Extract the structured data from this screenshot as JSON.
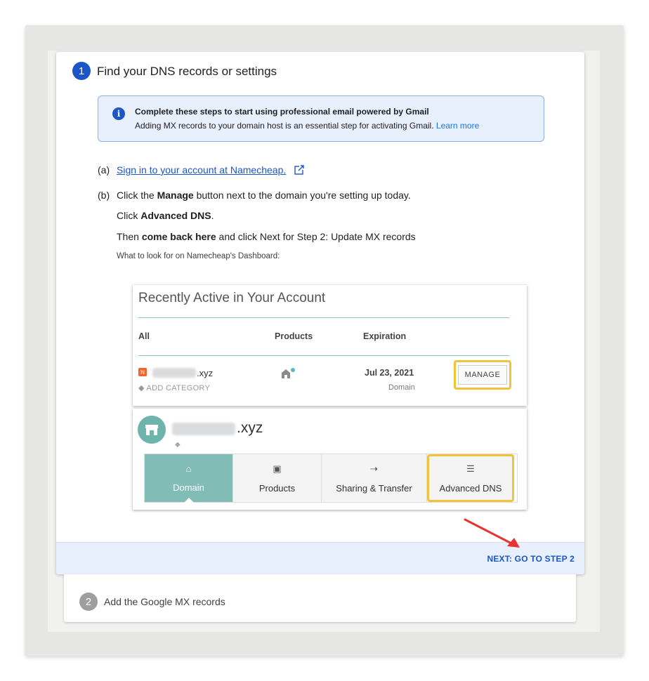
{
  "step1": {
    "number": "1",
    "title": "Find your DNS records or settings",
    "info": {
      "title": "Complete these steps to start using professional email powered by Gmail",
      "body": "Adding MX records to your domain host is an essential step for activating Gmail.",
      "link": "Learn more"
    },
    "a": {
      "label": "(a)",
      "link": "Sign in to your account at Namecheap."
    },
    "b": {
      "label": "(b)",
      "line1_pre": "Click the ",
      "line1_bold": "Manage",
      "line1_post": " button next to the domain you're setting up today.",
      "line2_pre": "Click ",
      "line2_bold": "Advanced DNS",
      "line2_post": ".",
      "line3_pre": "Then ",
      "line3_bold": "come back here",
      "line3_post": " and click Next for Step 2: Update MX records"
    },
    "note": "What to look for on Namecheap's Dashboard:",
    "next_button": "NEXT: GO TO STEP 2"
  },
  "namecheap": {
    "panel_title": "Recently Active in Your Account",
    "headers": {
      "all": "All",
      "products": "Products",
      "expiration": "Expiration"
    },
    "row": {
      "domain_suffix": ".xyz",
      "add_category": "ADD CATEGORY",
      "date": "Jul 23, 2021",
      "type": "Domain",
      "manage": "MANAGE"
    },
    "domain_header_suffix": ".xyz",
    "tabs": [
      {
        "label": "Domain",
        "icon": "home-icon"
      },
      {
        "label": "Products",
        "icon": "box-icon"
      },
      {
        "label": "Sharing & Transfer",
        "icon": "share-icon"
      },
      {
        "label": "Advanced DNS",
        "icon": "dns-icon"
      }
    ]
  },
  "step2": {
    "number": "2",
    "title": "Add the Google MX records"
  },
  "colors": {
    "accent": "#1a56c8",
    "highlight": "#f2c23a",
    "teal": "#82bcb6",
    "arrow": "#e8332e"
  }
}
